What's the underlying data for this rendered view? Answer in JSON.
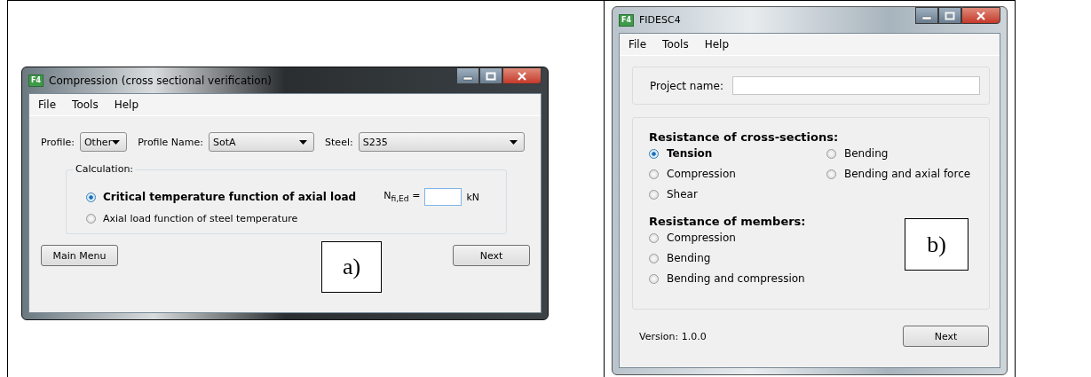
{
  "panels": [
    {
      "window": {
        "title": "Compression (cross sectional verification)",
        "icon": "F4"
      },
      "menu": [
        "File",
        "Tools",
        "Help"
      ],
      "fields": [
        {
          "label": "Profile:",
          "value": "Other"
        },
        {
          "label": "Profile Name:",
          "value": "SotA"
        },
        {
          "label": "Steel:",
          "value": "S235"
        }
      ],
      "group": {
        "title": "Calculation:",
        "options": [
          {
            "label": "Critical temperature function of axial load",
            "selected": true
          },
          {
            "label": "Axial load function of steel temperature",
            "selected": false
          }
        ],
        "input": {
          "label": "N$_{fi,Ed}$ =",
          "unit": "kN"
        }
      },
      "buttons": [
        "Main Menu",
        "Next"
      ],
      "caption": "a)"
    },
    {
      "window": {
        "title": "FIDESC4",
        "icon": "F4"
      },
      "menu": [
        "File",
        "Tools",
        "Help"
      ],
      "project": {
        "label": "Project name:"
      },
      "sections": [
        {
          "heading": "Resistance of cross-sections:",
          "options": [
            {
              "label": "Tension",
              "selected": true
            },
            {
              "label": "Compression",
              "selected": false
            },
            {
              "label": "Shear",
              "selected": false
            },
            {
              "label": "Bending",
              "selected": false
            },
            {
              "label": "Bending and axial force",
              "selected": false
            }
          ]
        },
        {
          "heading": "Resistance of members:",
          "options": [
            {
              "label": "Compression",
              "selected": false
            },
            {
              "label": "Bending",
              "selected": false
            },
            {
              "label": "Bending and compression",
              "selected": false
            }
          ]
        }
      ],
      "version": "Version: 1.0.0",
      "buttons": [
        "Next"
      ],
      "caption": "b)"
    }
  ]
}
